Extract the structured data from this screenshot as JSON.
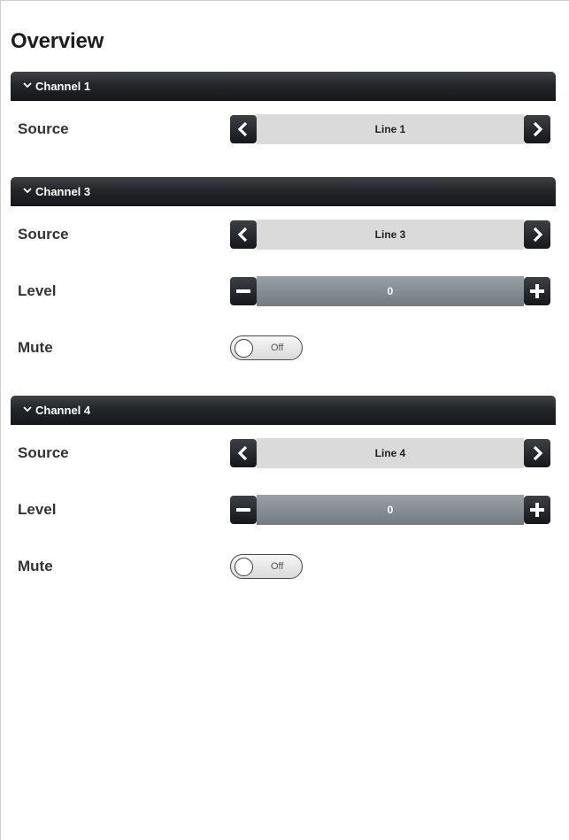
{
  "page": {
    "title": "Overview"
  },
  "channels": [
    {
      "header": "Channel 1",
      "source": {
        "label": "Source",
        "value": "Line 1"
      }
    },
    {
      "header": "Channel 3",
      "source": {
        "label": "Source",
        "value": "Line 3"
      },
      "level": {
        "label": "Level",
        "value": "0"
      },
      "mute": {
        "label": "Mute",
        "state": "Off"
      }
    },
    {
      "header": "Channel 4",
      "source": {
        "label": "Source",
        "value": "Line 4"
      },
      "level": {
        "label": "Level",
        "value": "0"
      },
      "mute": {
        "label": "Mute",
        "state": "Off"
      }
    }
  ],
  "icons": {
    "expand": "chevron-down-icon",
    "prev": "chevron-left-icon",
    "next": "chevron-right-icon",
    "minus": "minus-icon",
    "plus": "plus-icon"
  },
  "colors": {
    "header_bg": "#1e2124",
    "button_bg": "#25282b",
    "source_field_bg": "#dadada",
    "level_field_bg": "#858c91"
  }
}
